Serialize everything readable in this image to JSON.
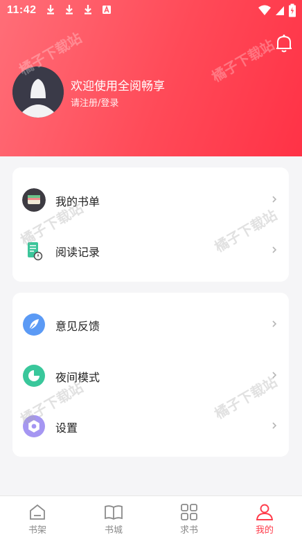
{
  "status_bar": {
    "time": "11:42",
    "left_icons": [
      "download-icon",
      "download-icon",
      "download-icon",
      "a-icon"
    ],
    "right_icons": [
      "wifi-icon",
      "signal-icon",
      "battery-icon"
    ]
  },
  "header": {
    "welcome": "欢迎使用全阅畅享",
    "login": "请注册/登录",
    "gradient": [
      "#ff6e78",
      "#ff3246"
    ]
  },
  "menu_group1": [
    {
      "label": "我的书单",
      "icon": "booklist-icon"
    },
    {
      "label": "阅读记录",
      "icon": "reading-record-icon"
    }
  ],
  "menu_group2": [
    {
      "label": "意见反馈",
      "icon": "feedback-icon"
    },
    {
      "label": "夜间模式",
      "icon": "night-mode-icon"
    },
    {
      "label": "设置",
      "icon": "settings-icon"
    }
  ],
  "watermark": "橘子下载站",
  "bottom_nav": [
    {
      "label": "书架",
      "icon": "bookshelf-icon",
      "active": false
    },
    {
      "label": "书城",
      "icon": "bookstore-icon",
      "active": false
    },
    {
      "label": "求书",
      "icon": "request-book-icon",
      "active": false
    },
    {
      "label": "我的",
      "icon": "profile-icon",
      "active": true
    }
  ],
  "colors": {
    "accent": "#ff3b4a",
    "background": "#f5f5f7"
  }
}
